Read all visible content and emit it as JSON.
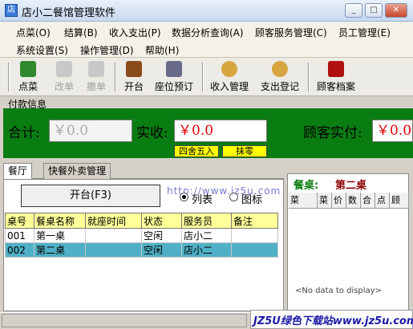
{
  "window": {
    "title": "店小二餐馆管理软件",
    "min": "_",
    "max": "□",
    "close": "✕"
  },
  "menu": {
    "row1": [
      "点菜(O)",
      "结算(B)",
      "收入支出(P)",
      "数据分析查询(A)",
      "顾客服务管理(C)",
      "员工管理(E)"
    ],
    "row2": [
      "系统设置(S)",
      "操作管理(D)",
      "帮助(H)"
    ]
  },
  "toolbar": [
    {
      "label": "点菜",
      "icon": "leaf-icon",
      "color": "#2f8a2f",
      "enabled": true
    },
    {
      "label": "改单",
      "icon": "pencil-icon",
      "color": "#b7b7b7",
      "enabled": false
    },
    {
      "label": "撤单",
      "icon": "eraser-icon",
      "color": "#b7b7b7",
      "enabled": false
    },
    {
      "label": "开台",
      "icon": "table-icon",
      "color": "#8b4a1a",
      "enabled": true
    },
    {
      "label": "座位预订",
      "icon": "phone-icon",
      "color": "#6a6a8a",
      "enabled": true
    },
    {
      "label": "收入管理",
      "icon": "moneybag-icon",
      "color": "#d8a640",
      "enabled": true
    },
    {
      "label": "支出登记",
      "icon": "moneybag-icon",
      "color": "#d8a640",
      "enabled": true
    },
    {
      "label": "顾客档案",
      "icon": "book-icon",
      "color": "#b01010",
      "enabled": true
    }
  ],
  "payment": {
    "legend": "付款信息",
    "total_label": "合计:",
    "total_value": "￥0.0",
    "received_label": "实收:",
    "received_value": "￥0.0",
    "round_btn": "四舍五入",
    "zero_btn": "抹零",
    "customer_paid_label": "顾客实付:",
    "customer_paid_value": "￥0.0"
  },
  "tabs": [
    "餐厅",
    "快餐外卖管理"
  ],
  "open_desk_btn": "开台(F3)",
  "view": {
    "list": "列表",
    "icon": "图标",
    "watermark_url": "http://www.jz5u.com"
  },
  "grid": {
    "headers": [
      "桌号",
      "餐桌名称",
      "就座时间",
      "状态",
      "服务员",
      "备注"
    ],
    "rows": [
      [
        "001",
        "第一桌",
        "",
        "空闲",
        "店小二",
        ""
      ],
      [
        "002",
        "第二桌",
        "",
        "空闲",
        "店小二",
        ""
      ]
    ]
  },
  "right": {
    "desk_label": "餐桌:",
    "desk_value": "第二桌",
    "headers": [
      "菜",
      "菜",
      "价",
      "数",
      "合",
      "点",
      "顾"
    ],
    "no_data": "<No data to display>"
  },
  "watermark": "JZ5U绿色下载站www.jz5u.com",
  "colors": {
    "pay_bg": "#0a7d12",
    "header_bg": "#ffff99",
    "selected_row": "#4fb0c6",
    "money_red": "#e00000"
  }
}
